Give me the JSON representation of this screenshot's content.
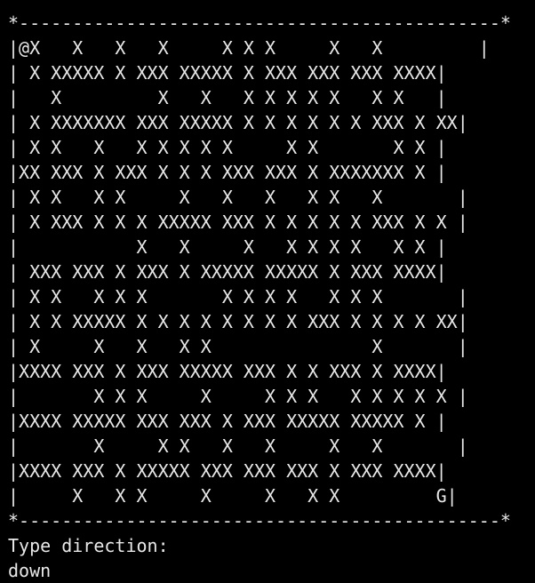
{
  "terminal": {
    "prompt_prev": "   ",
    "border_top": "*---------------------------------------------*",
    "maze_rows": [
      "|@X   X   X   X     X X X     X   X         |",
      "| X XXXXX X XXX XXXXX X XXX XXX XXX XXXX|",
      "|   X         X   X   X X X X X   X X   |",
      "| X XXXXXXX XXX XXXXX X X X X X X XXX X XX|",
      "| X X   X   X X X X X     X X       X X |",
      "|XX XXX X XXX X X X XXX XXX X XXXXXXX X |",
      "| X X   X X     X   X   X   X X   X       |",
      "| X XXX X X X XXXXX XXX X X X X X XXX X X |",
      "|           X   X     X   X X X X   X X |",
      "| XXX XXX X XXX X XXXXX XXXXX X XXX XXXX|",
      "| X X   X X X       X X X X   X X X       |",
      "| X X XXXXX X X X X X X X X XXX X X X X XX|",
      "| X     X   X   X X               X       |",
      "|XXXX XXX X XXX XXXXX XXX X X XXX X XXXX|",
      "|       X X X     X     X X X   X X X X X |",
      "|XXXX XXXXX XXX XXX X XXX XXXXX XXXXX X |",
      "|       X     X X   X   X     X   X       |",
      "|XXXX XXX X XXXXX XXX XXX XXX X XXX XXXX|",
      "|     X   X X     X     X   X X         G|"
    ],
    "border_bottom": "*---------------------------------------------*",
    "prompt": "Type direction:",
    "input_value": "down"
  }
}
